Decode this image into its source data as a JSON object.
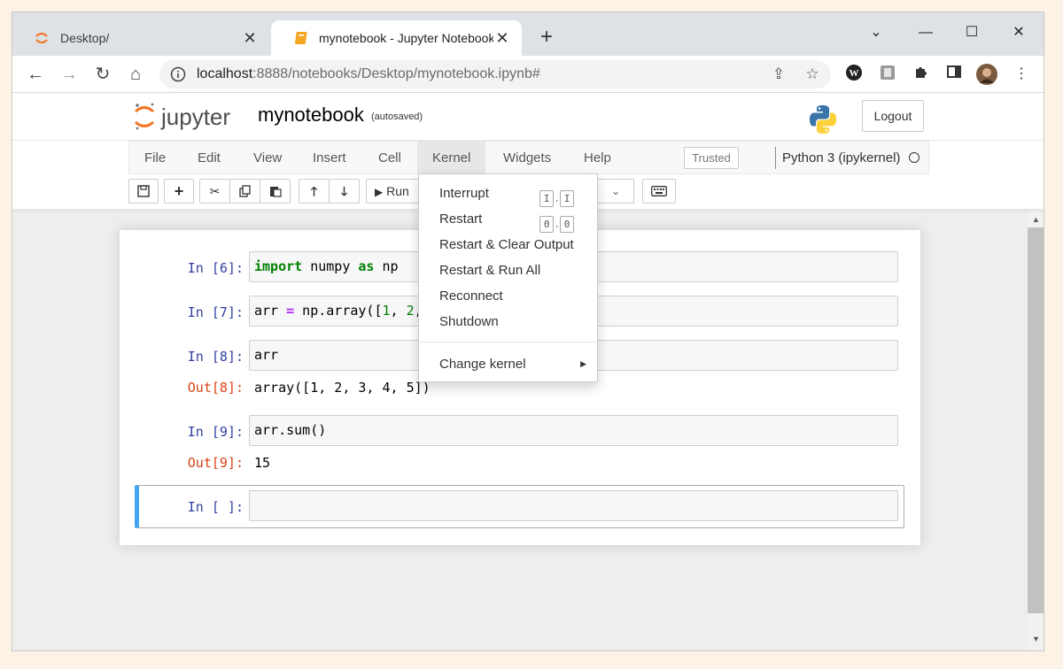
{
  "browser": {
    "tabs": [
      {
        "title": "Desktop/",
        "favicon": "jupyter-favicon",
        "active": false
      },
      {
        "title": "mynotebook - Jupyter Notebook",
        "favicon": "notebook-favicon",
        "active": true
      }
    ],
    "url_host": "localhost",
    "url_rest": ":8888/notebooks/Desktop/mynotebook.ipynb#"
  },
  "header": {
    "logo_text": "jupyter",
    "notebook_name": "mynotebook",
    "autosave_status": "(autosaved)",
    "logout_label": "Logout"
  },
  "menubar": {
    "items": [
      "File",
      "Edit",
      "View",
      "Insert",
      "Cell",
      "Kernel",
      "Widgets",
      "Help"
    ],
    "open_menu": "Kernel",
    "trusted_label": "Trusted",
    "kernel_name": "Python 3 (ipykernel)"
  },
  "toolbar": {
    "run_label": "Run"
  },
  "kernel_menu": {
    "interrupt": "Interrupt",
    "interrupt_keys": [
      "I",
      "I"
    ],
    "restart": "Restart",
    "restart_keys": [
      "0",
      "0"
    ],
    "restart_clear": "Restart & Clear Output",
    "restart_run_all": "Restart & Run All",
    "reconnect": "Reconnect",
    "shutdown": "Shutdown",
    "change_kernel": "Change kernel"
  },
  "cells": [
    {
      "prompt": "In [6]:"
    },
    {
      "prompt": "In [7]:",
      "code_visible": "arr = np.array([1, 2,"
    },
    {
      "prompt": "In [8]:",
      "code": "arr",
      "out_prompt": "Out[8]:",
      "output": "array([1, 2, 3, 4, 5])"
    },
    {
      "prompt": "In [9]:",
      "code": "arr.sum()",
      "out_prompt": "Out[9]:",
      "output": "15"
    },
    {
      "prompt": "In [ ]:",
      "code": ""
    }
  ],
  "colors": {
    "in_prompt": "#303f9f",
    "out_prompt": "#d84315",
    "selected_cell_bar": "#42a5f5",
    "keyword": "#008000"
  }
}
